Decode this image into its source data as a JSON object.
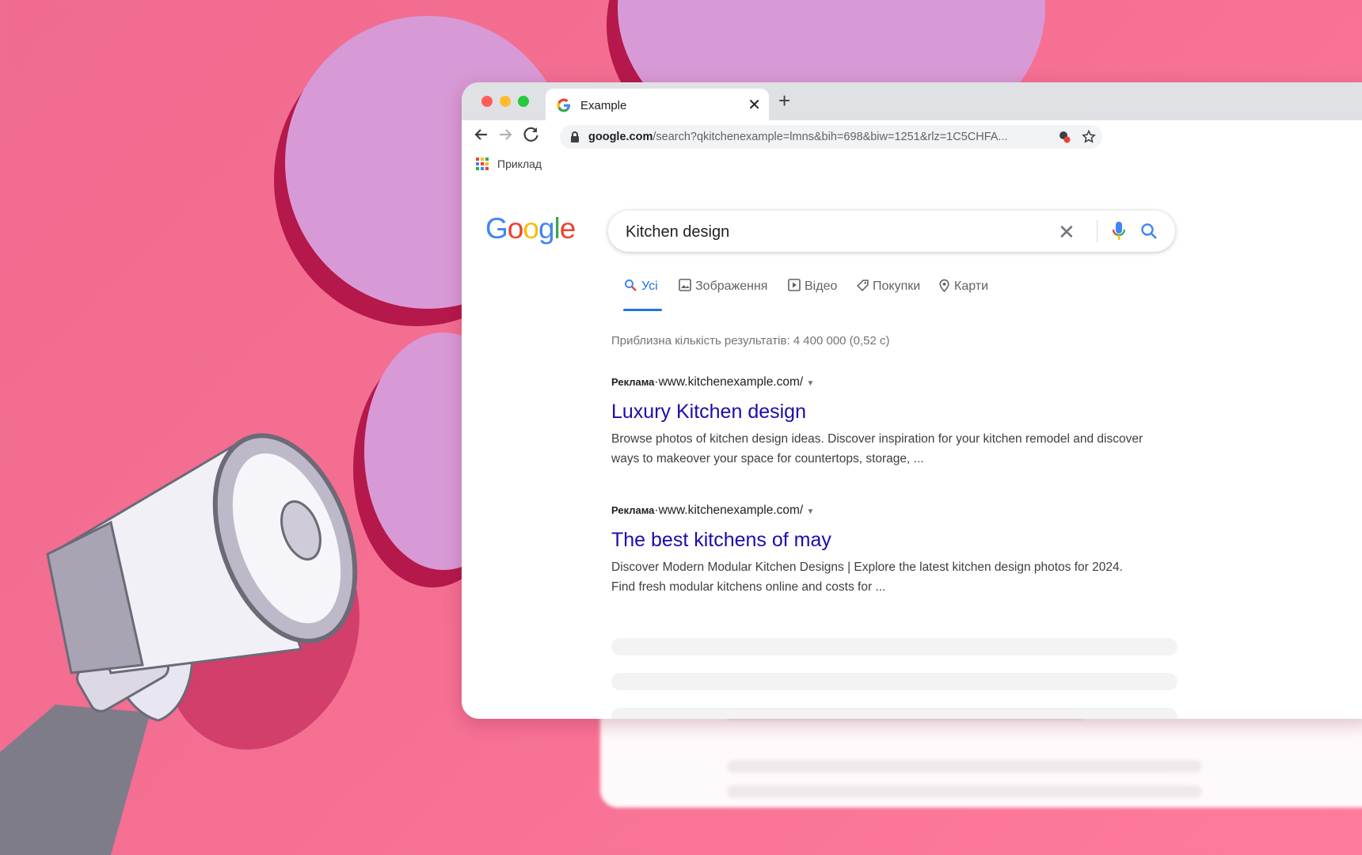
{
  "browser": {
    "tab_title": "Example",
    "url_domain": "google.com",
    "url_path": "/search?qkitchenexample=lmns&bih=698&biw=1251&rlz=1C5CHFA...",
    "bookmark_label": "Приклад"
  },
  "google": {
    "logo_letters": [
      "G",
      "o",
      "o",
      "g",
      "l",
      "e"
    ],
    "logo_colors": [
      "#4285f4",
      "#ea4335",
      "#fbbc05",
      "#4285f4",
      "#34a853",
      "#ea4335"
    ],
    "search_query": "Kitchen design"
  },
  "nav_tabs": [
    {
      "label": "Усі",
      "icon": "search-icon",
      "active": true
    },
    {
      "label": "Зображення",
      "icon": "image-icon",
      "active": false
    },
    {
      "label": "Відео",
      "icon": "video-icon",
      "active": false
    },
    {
      "label": "Покупки",
      "icon": "tag-icon",
      "active": false
    },
    {
      "label": "Карти",
      "icon": "map-pin-icon",
      "active": false
    }
  ],
  "result_stats": "Приблизна кількість результатів: 4 400 000 (0,52 с)",
  "ads": [
    {
      "label": "Реклама",
      "separator": "·",
      "url": "www.kitchenexample.com/",
      "title": "Luxury Kitchen design",
      "desc_line1": "Browse photos of kitchen design ideas. Discover inspiration for your kitchen remodel and discover",
      "desc_line2": "ways to makeover your space for countertops, storage, ..."
    },
    {
      "label": "Реклама",
      "separator": "·",
      "url": "www.kitchenexample.com/",
      "title": "The best kitchens of may",
      "desc_line1": "Discover Modern Modular Kitchen Designs | Explore the latest kitchen design photos for 2024.",
      "desc_line2": "Find fresh modular kitchens online and costs for ..."
    }
  ],
  "colors": {
    "background": "#f56f92",
    "circles": "#d89ad6",
    "link": "#1a0dab",
    "accent": "#1a73e8"
  }
}
